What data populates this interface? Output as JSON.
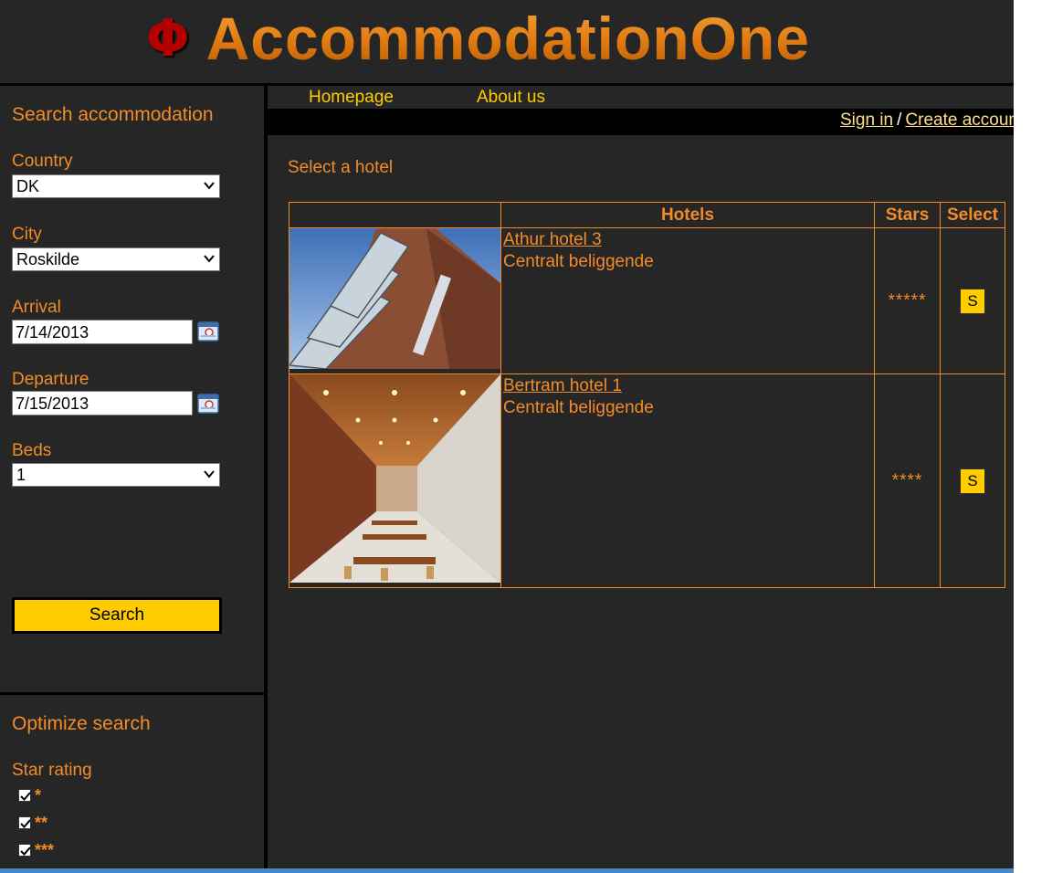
{
  "header": {
    "logo_symbol": "Φ",
    "logo_text": "AccommodationOne"
  },
  "nav": {
    "home": "Homepage",
    "about": "About us"
  },
  "auth": {
    "sign_in": "Sign in",
    "separator": "/",
    "create_account": "Create account"
  },
  "sidebar": {
    "title": "Search accommodation",
    "country_label": "Country",
    "country_value": "DK",
    "city_label": "City",
    "city_value": "Roskilde",
    "arrival_label": "Arrival",
    "arrival_value": "7/14/2013",
    "departure_label": "Departure",
    "departure_value": "7/15/2013",
    "beds_label": "Beds",
    "beds_value": "1",
    "search_button": "Search",
    "optimize_title": "Optimize search",
    "star_rating_label": "Star rating",
    "star_options": [
      {
        "label": "*",
        "checked": true
      },
      {
        "label": "**",
        "checked": true
      },
      {
        "label": "***",
        "checked": true
      }
    ]
  },
  "main": {
    "title": "Select a hotel",
    "columns": [
      "",
      "Hotels",
      "Stars",
      "Select"
    ],
    "hotels": [
      {
        "name": "Athur hotel 3",
        "description": "Centralt beliggende",
        "stars": "*****",
        "select_label": "S"
      },
      {
        "name": "Bertram hotel 1",
        "description": "Centralt beliggende",
        "stars": "****",
        "select_label": "S"
      }
    ]
  },
  "colors": {
    "background": "#262626",
    "accent": "#f28c28",
    "button": "#ffcc00",
    "logo_red": "#b30000"
  }
}
